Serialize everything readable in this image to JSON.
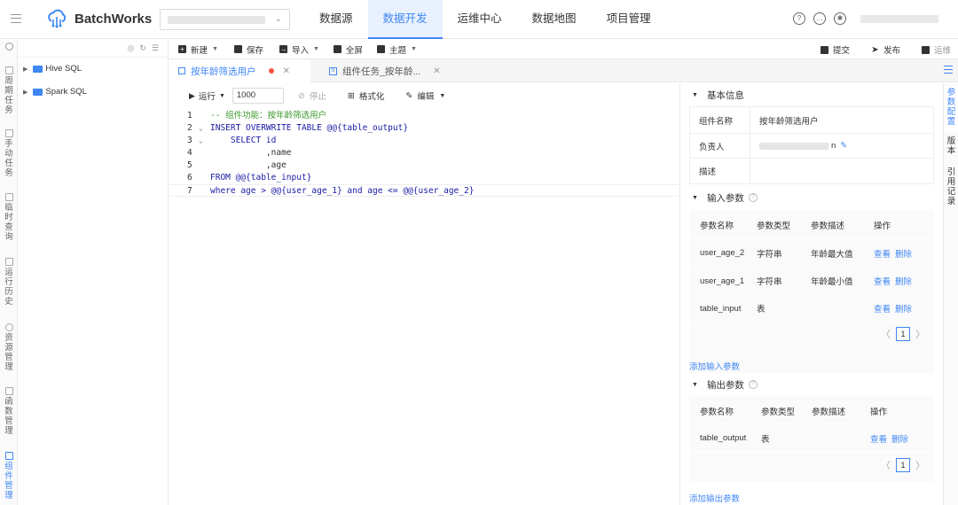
{
  "app": {
    "name": "BatchWorks"
  },
  "header": {
    "nav": [
      "数据源",
      "数据开发",
      "运维中心",
      "数据地图",
      "项目管理"
    ],
    "active_nav": "数据开发"
  },
  "sidebar": {
    "items": [
      "周期任务",
      "手动任务",
      "临时查询",
      "运行历史",
      "资源管理",
      "函数管理",
      "组件管理"
    ],
    "active": "组件管理"
  },
  "tree": {
    "nodes": [
      "Hive SQL",
      "Spark SQL"
    ]
  },
  "toolbar": {
    "new": "新建",
    "save": "保存",
    "import": "导入",
    "fullscreen": "全屏",
    "theme": "主题",
    "submit": "提交",
    "publish": "发布",
    "ops": "运维"
  },
  "tabs": [
    {
      "label": "按年龄筛选用户",
      "active": true
    },
    {
      "label": "组件任务_按年龄...",
      "active": false
    }
  ],
  "editor": {
    "run": "运行",
    "limit": "1000",
    "stop": "停止",
    "format": "格式化",
    "edit": "编辑",
    "lines": [
      "-- 组件功能：按年龄筛选用户",
      "INSERT OVERWRITE TABLE @@{table_output}",
      "    SELECT id",
      "           ,name",
      "           ,age",
      "FROM @@{table_input}",
      "where age > @@{user_age_1} and age <= @@{user_age_2}"
    ]
  },
  "basic_info": {
    "title": "基本信息",
    "fields": [
      {
        "label": "组件名称",
        "value": "按年龄筛选用户"
      },
      {
        "label": "负责人",
        "value": "n"
      },
      {
        "label": "描述",
        "value": ""
      }
    ]
  },
  "input_params": {
    "title": "输入参数",
    "headers": [
      "参数名称",
      "参数类型",
      "参数描述",
      "操作"
    ],
    "rows": [
      {
        "name": "user_age_2",
        "type": "字符串",
        "desc": "年龄最大值"
      },
      {
        "name": "user_age_1",
        "type": "字符串",
        "desc": "年龄最小值"
      },
      {
        "name": "table_input",
        "type": "表",
        "desc": ""
      }
    ],
    "view": "查看",
    "delete": "删除",
    "page": "1",
    "add": "添加输入参数"
  },
  "output_params": {
    "title": "输出参数",
    "headers": [
      "参数名称",
      "参数类型",
      "参数描述",
      "操作"
    ],
    "rows": [
      {
        "name": "table_output",
        "type": "表",
        "desc": ""
      }
    ],
    "view": "查看",
    "delete": "删除",
    "page": "1",
    "add": "添加输出参数"
  },
  "right_tabs": [
    "参数配置",
    "版本",
    "引用记录"
  ]
}
